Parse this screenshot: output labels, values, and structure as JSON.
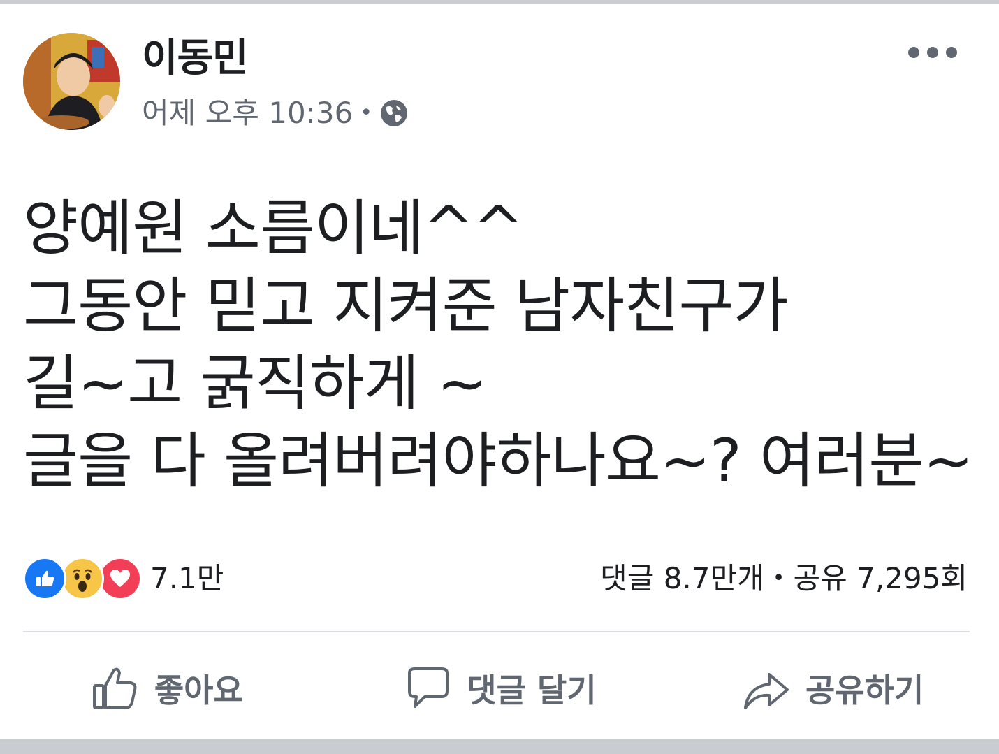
{
  "post": {
    "author": "이동민",
    "timestamp": "어제 오후 10:36",
    "separator": "•",
    "privacy_icon": "globe-icon",
    "more_icon": "more-horizontal-icon",
    "lines": [
      "양예원 소름이네^^",
      "그동안 믿고 지켜준 남자친구가",
      "길~고 굵직하게 ~",
      "글을 다 올려버려야하나요~? 여러분~"
    ]
  },
  "reactions": {
    "icons": [
      "like-reaction-icon",
      "wow-reaction-icon",
      "love-reaction-icon"
    ],
    "count": "7.1만"
  },
  "stats": {
    "comments": "댓글 8.7만개",
    "separator": "•",
    "shares": "공유 7,295회"
  },
  "actions": {
    "like": "좋아요",
    "comment": "댓글 달기",
    "share": "공유하기"
  },
  "colors": {
    "text": "#1c1e21",
    "secondary": "#606770",
    "like_blue": "#1877f2",
    "wow_yellow": "#f7c548",
    "love_red": "#f33e58",
    "frame_gray": "#c9ccd1"
  }
}
